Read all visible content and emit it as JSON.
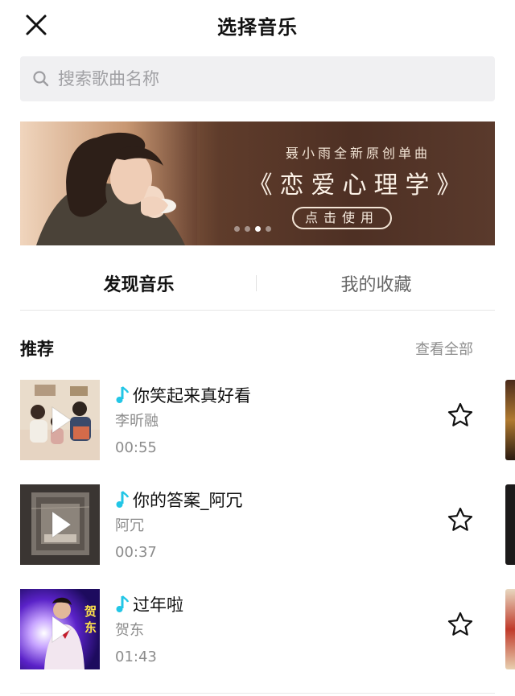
{
  "header": {
    "title": "选择音乐",
    "close_icon": "close-icon"
  },
  "search": {
    "placeholder": "搜索歌曲名称",
    "icon": "search-icon"
  },
  "banner": {
    "subtitle": "聂小雨全新原创单曲",
    "title": "《恋爱心理学》",
    "cta": "点击使用",
    "dots_total": 4,
    "active_dot": 3
  },
  "tabs": [
    {
      "label": "发现音乐",
      "active": true
    },
    {
      "label": "我的收藏",
      "active": false
    }
  ],
  "section": {
    "title": "推荐",
    "see_all": "查看全部"
  },
  "songs": [
    {
      "title": "你笑起来真好看",
      "artist": "李昕融",
      "duration": "00:55"
    },
    {
      "title": "你的答案_阿冗",
      "artist": "阿冗",
      "duration": "00:37"
    },
    {
      "title": "过年啦",
      "artist": "贺东",
      "duration": "01:43",
      "cover_text": "贺东"
    }
  ],
  "icons": {
    "note": "music-note-icon",
    "favorite": "star-outline-icon",
    "play": "play-icon"
  },
  "colors": {
    "note_accent": "#22c6e6",
    "banner_bg": "#5a3a2c",
    "search_bg": "#f0f0f2"
  }
}
